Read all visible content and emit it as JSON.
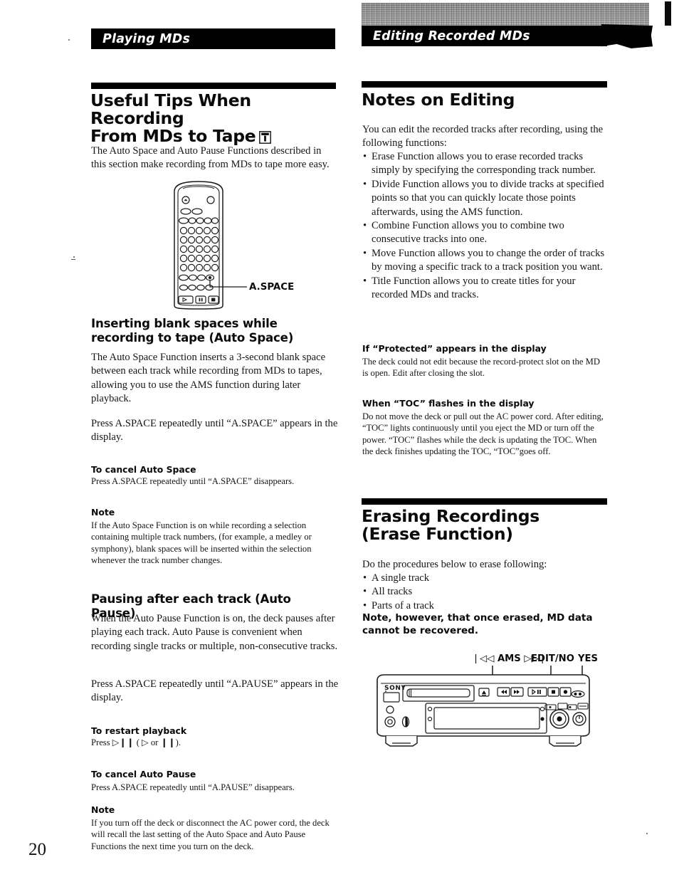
{
  "page": {
    "number": "20"
  },
  "running_heads": {
    "left": "Playing MDs",
    "right": "Editing Recorded MDs"
  },
  "left_column": {
    "section_title_line1": "Useful Tips When Recording",
    "section_title_line2": "From MDs to Tape",
    "section_title_icon": "tip-info-icon",
    "intro": "The Auto Space and Auto Pause Functions described in this section make recording from MDs to tape more easy.",
    "figure": {
      "name": "remote-control-diagram",
      "callout_label": "A.SPACE"
    },
    "auto_space": {
      "heading": "Inserting blank spaces while recording to tape (Auto Space)",
      "paragraph1": "The Auto Space Function inserts a 3-second blank space between each track while recording from MDs to tapes, allowing you to use the AMS function during later playback.",
      "paragraph2": "Press A.SPACE repeatedly until “A.SPACE” appears in the display."
    },
    "cancel_auto_space": {
      "heading": "To cancel Auto Space",
      "body": "Press A.SPACE repeatedly until “A.SPACE” disappears."
    },
    "note_auto_space": {
      "heading": "Note",
      "body": "If the Auto Space Function is on while recording a selection containing multiple track numbers, (for example, a medley or symphony), blank spaces will be inserted within the selection whenever the track number changes."
    },
    "auto_pause": {
      "heading": "Pausing after each track (Auto Pause)",
      "paragraph1": "When the Auto Pause Function is on, the deck pauses after playing each track.  Auto Pause is convenient when recording single tracks or multiple, non-consecutive tracks.",
      "paragraph2": "Press A.SPACE repeatedly until “A.PAUSE” appears in the display."
    },
    "restart_playback": {
      "heading": "To restart playback",
      "body_before": "Press ",
      "symbol_playpause": "▷❙❙",
      "body_mid": " ( ",
      "symbol_play": "▷",
      "body_or": " or ",
      "symbol_pause": "❙❙",
      "body_after": ")."
    },
    "cancel_auto_pause": {
      "heading": "To cancel Auto Pause",
      "body": "Press A.SPACE repeatedly until “A.PAUSE” disappears."
    },
    "note_auto_pause": {
      "heading": "Note",
      "body": "If you turn off the deck or disconnect the AC power cord, the deck will recall the last setting of the Auto Space and Auto Pause Functions the next time you turn on the deck."
    }
  },
  "right_column": {
    "notes_on_editing": {
      "title": "Notes on Editing",
      "intro": "You can edit the recorded tracks after recording, using the following functions:",
      "bullets": [
        "Erase Function allows you to erase recorded tracks simply by specifying the corresponding track number.",
        "Divide Function allows you to divide tracks at specified points so that you can quickly locate those points afterwards, using the AMS function.",
        "Combine Function allows you to combine two consecutive tracks into one.",
        "Move Function allows you to change the order of tracks by moving a specific track to a track position you want.",
        "Title Function allows you to create titles for your recorded MDs and tracks."
      ]
    },
    "protected_note": {
      "heading": "If “Protected” appears in the display",
      "body": "The deck could not edit because the record-protect slot on the MD is open.  Edit after closing the slot."
    },
    "toc_note": {
      "heading": "When “TOC” flashes in the display",
      "body": "Do not move the deck or pull out the AC power cord.  After editing, “TOC” lights continuously until you eject the MD or turn off the power.  “TOC” flashes while the deck is updating the TOC.  When the deck finishes updating the TOC, “TOC”goes off."
    },
    "erasing": {
      "title_line1": "Erasing Recordings",
      "title_line2": "(Erase Function)",
      "intro": "Do the procedures below to erase following:",
      "bullets": [
        "A single track",
        "All tracks",
        "Parts of a track"
      ],
      "warning": "Note, however, that once erased, MD data cannot be recovered."
    },
    "deck_figure": {
      "name": "md-deck-front-panel-diagram",
      "brand": "SONY",
      "callouts": [
        {
          "symbol": "❘◁◁",
          "label": "AMS",
          "symbol2": "▷▷❘"
        },
        {
          "label": "EDIT/NO"
        },
        {
          "label": "YES"
        }
      ],
      "transport_buttons": [
        "◀◀",
        "▶▶",
        "▷❙❙",
        "■",
        "●"
      ],
      "eject_button": "▲"
    }
  }
}
